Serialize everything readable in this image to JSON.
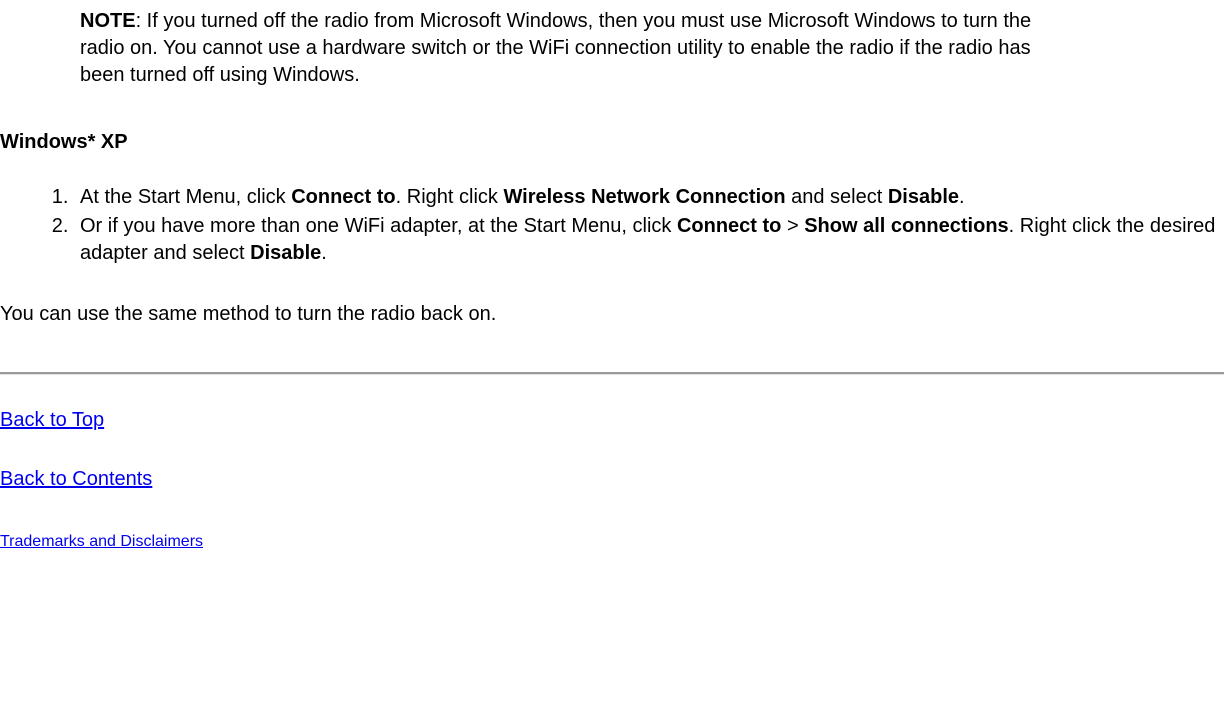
{
  "note": {
    "label": "NOTE",
    "text": ": If you turned off the radio from Microsoft Windows, then you must use Microsoft Windows to turn the radio on. You cannot use a hardware switch or the WiFi connection utility to enable the radio if the radio has been turned off using Windows."
  },
  "section_heading": "Windows* XP",
  "steps": {
    "s1": {
      "t1": "At the Start Menu, click ",
      "b1": "Connect to",
      "t2": ". Right click ",
      "b2": "Wireless Network Connection",
      "t3": " and select ",
      "b3": "Disable",
      "t4": "."
    },
    "s2": {
      "t1": "Or if you have more than one WiFi adapter, at the Start Menu, click ",
      "b1": "Connect to",
      "t2": " > ",
      "b2": "Show all connections",
      "t3": ". Right click the desired adapter and select ",
      "b3": "Disable",
      "t4": "."
    }
  },
  "closing_para": "You can use the same method to turn the radio back on.",
  "links": {
    "back_to_top": "Back to Top",
    "back_to_contents": "Back to Contents",
    "trademarks": "Trademarks and Disclaimers"
  }
}
